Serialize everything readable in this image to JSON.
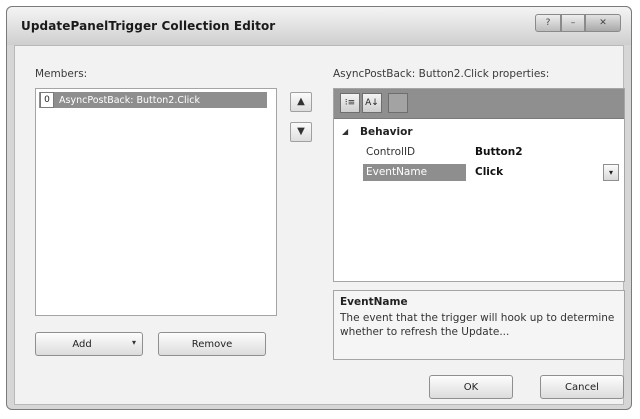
{
  "window": {
    "title": "UpdatePanelTrigger Collection Editor",
    "help_glyph": "?",
    "minimize_glyph": "–",
    "close_glyph": "✕"
  },
  "members": {
    "label": "Members:",
    "items": [
      {
        "index": "0",
        "text": "AsyncPostBack: Button2.Click",
        "selected": true
      }
    ],
    "move_up_glyph": "▲",
    "move_down_glyph": "▼"
  },
  "buttons": {
    "add": "Add",
    "add_dropdown_glyph": "▾",
    "remove": "Remove",
    "ok": "OK",
    "cancel": "Cancel"
  },
  "properties": {
    "label": "AsyncPostBack: Button2.Click properties:",
    "toolbar": {
      "categorized_glyph": "⁝≡",
      "alphabetical_glyph": "A↓"
    },
    "category": {
      "name": "Behavior",
      "toggle_glyph": "◢"
    },
    "rows": [
      {
        "name": "ControlID",
        "value": "Button2"
      },
      {
        "name": "EventName",
        "value": "Click",
        "selected": true,
        "dropdown_glyph": "▾"
      }
    ],
    "description": {
      "title": "EventName",
      "text": "The event that the trigger will hook up to determine whether to refresh the Update..."
    }
  }
}
